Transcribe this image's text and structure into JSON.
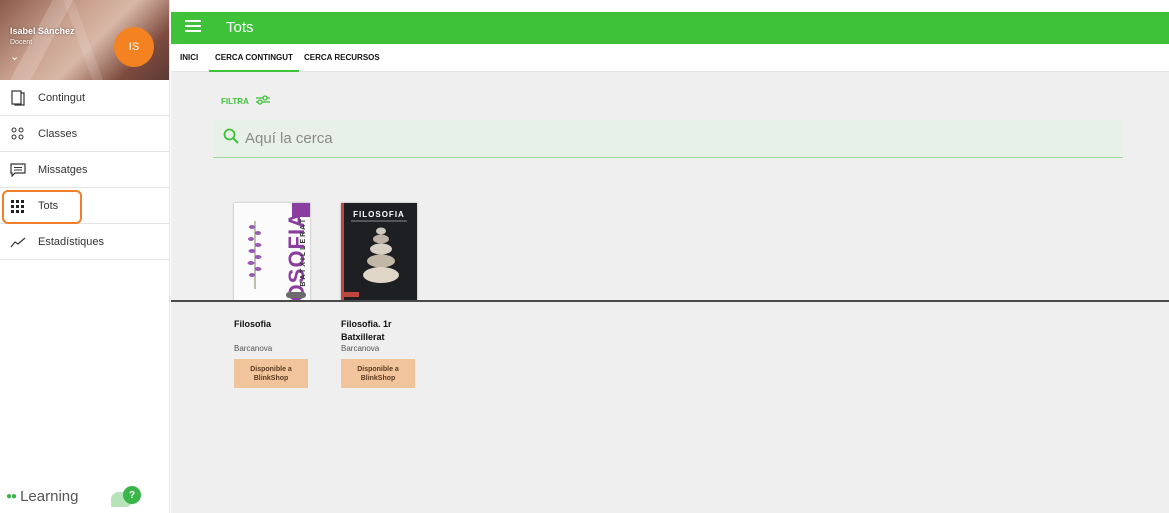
{
  "user": {
    "name": "Isabel Sánchez",
    "role": "Docent",
    "initials": "IS"
  },
  "sidebar": {
    "items": [
      {
        "label": "Contingut",
        "icon": "book-icon"
      },
      {
        "label": "Classes",
        "icon": "people-icon"
      },
      {
        "label": "Missatges",
        "icon": "message-icon"
      },
      {
        "label": "Tots",
        "icon": "grid-icon",
        "active": true
      },
      {
        "label": "Estadístiques",
        "icon": "trend-icon"
      }
    ],
    "brand": "Learning",
    "help_badge": "?"
  },
  "header": {
    "title": "Tots"
  },
  "tabs": [
    {
      "label": "INICI"
    },
    {
      "label": "CERCA CONTINGUT",
      "active": true
    },
    {
      "label": "CERCA RECURSOS"
    }
  ],
  "filter": {
    "label": "FILTRA"
  },
  "search": {
    "placeholder": "Aquí la cerca"
  },
  "books": [
    {
      "title": "Filosofia",
      "publisher": "Barcanova",
      "button": "Disponible a BlinkShop",
      "cover": {
        "vertical_title": "FILOSOFIA",
        "vertical_subtitle": "BATXILLERAT"
      }
    },
    {
      "title": "Filosofia. 1r Batxillerat",
      "publisher": "Barcanova",
      "button": "Disponible a BlinkShop",
      "cover": {
        "title": "FILOSOFIA"
      }
    }
  ],
  "colors": {
    "accent": "#3ec23a",
    "avatar": "#f58220",
    "button_bg": "#f2c49b",
    "highlight": "#f07f2c"
  }
}
